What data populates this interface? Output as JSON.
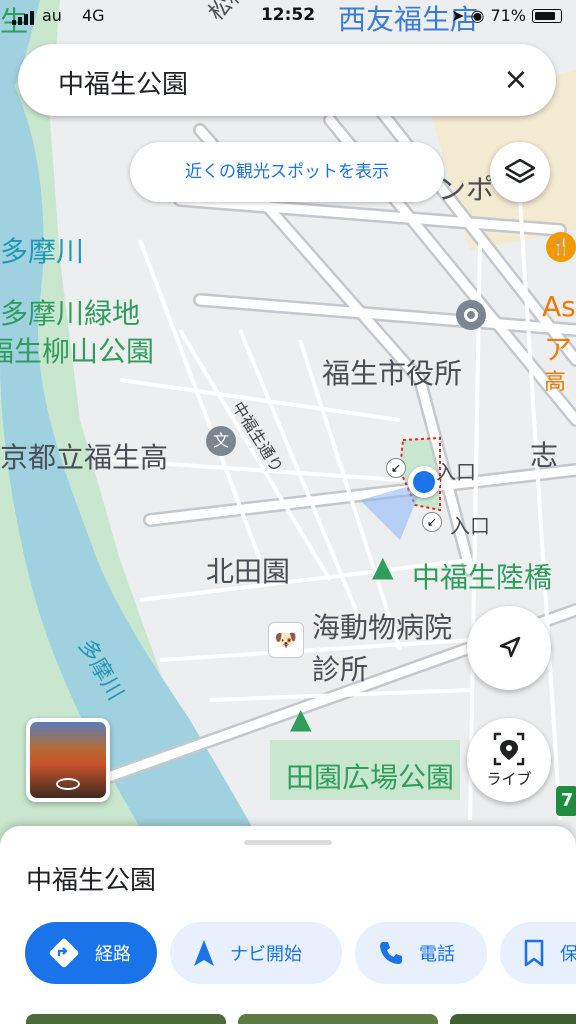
{
  "status": {
    "carrier": "au",
    "network": "4G",
    "time": "12:52",
    "battery": "71%",
    "battery_level": 0.71
  },
  "search": {
    "query": "中福生公園",
    "close_icon": "×"
  },
  "chips": {
    "tour": "近くの観光スポットを表示"
  },
  "buttons": {
    "live": "ライブ"
  },
  "map": {
    "labels": {
      "tama_river_top": "多摩川",
      "tama_river_side": "多摩川",
      "tama_ryokuchi": "多摩川緑地",
      "yanagiyama": "福生柳山公園",
      "high_school": "京都立福生高",
      "city_hall": "福生市役所",
      "road": "中福生通り",
      "kitadaen": "北田園",
      "entrance1": "入口",
      "entrance2": "入口",
      "park_rikkyo": "中福生陸橋",
      "hospital1": "海動物病院",
      "hospital2": "診所",
      "denen": "田園広場公園",
      "nishitomo": "西友福生店",
      "matsubayashi": "松林通",
      "shi": "志",
      "as": "As",
      "a": "ア",
      "koushi": "高",
      "po": "ンポ",
      "route_badge": "7",
      "top_left": "生"
    }
  },
  "sheet": {
    "title": "中福生公園",
    "actions": [
      "経路",
      "ナビ開始",
      "電話",
      "保"
    ]
  },
  "colors": {
    "accent": "#1a73e8",
    "park": "#2f9d5b",
    "water": "#1f97b5"
  }
}
